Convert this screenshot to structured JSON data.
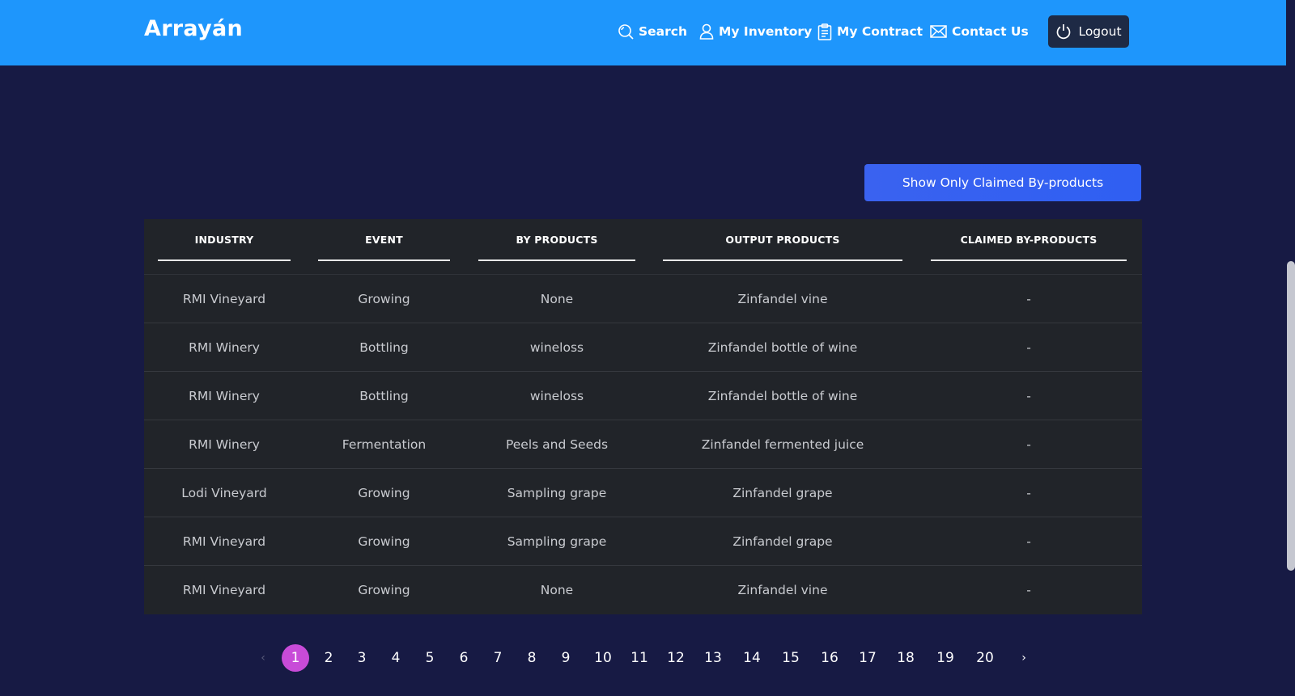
{
  "header": {
    "brand": "Arrayán",
    "nav": {
      "search": "Search",
      "inventory": "My Inventory",
      "contract": "My Contract",
      "contact": "Contact Us"
    },
    "logout": "Logout"
  },
  "filter_button": "Show Only Claimed By-products",
  "table": {
    "headers": [
      "INDUSTRY",
      "EVENT",
      "BY PRODUCTS",
      "OUTPUT PRODUCTS",
      "CLAIMED BY-PRODUCTS"
    ],
    "rows": [
      [
        "RMI Vineyard",
        "Growing",
        "None",
        "Zinfandel vine",
        "-"
      ],
      [
        "RMI Winery",
        "Bottling",
        "wineloss",
        "Zinfandel bottle of wine",
        "-"
      ],
      [
        "RMI Winery",
        "Bottling",
        "wineloss",
        "Zinfandel bottle of wine",
        "-"
      ],
      [
        "RMI Winery",
        "Fermentation",
        "Peels and Seeds",
        "Zinfandel fermented juice",
        "-"
      ],
      [
        "Lodi Vineyard",
        "Growing",
        "Sampling grape",
        "Zinfandel grape",
        "-"
      ],
      [
        "RMI Vineyard",
        "Growing",
        "Sampling grape",
        "Zinfandel grape",
        "-"
      ],
      [
        "RMI Vineyard",
        "Growing",
        "None",
        "Zinfandel vine",
        "-"
      ]
    ]
  },
  "pagination": {
    "prev": "‹",
    "next": "›",
    "pages": [
      "1",
      "2",
      "3",
      "4",
      "5",
      "6",
      "7",
      "8",
      "9",
      "10",
      "11",
      "12",
      "13",
      "14",
      "15",
      "16",
      "17",
      "18",
      "19",
      "20"
    ],
    "current": "1"
  },
  "colors": {
    "header_bg": "#1e96fc",
    "page_bg": "#171a44",
    "table_bg": "#212429",
    "active_page": "#c84bd8",
    "filter_button": "#3a62f0"
  }
}
